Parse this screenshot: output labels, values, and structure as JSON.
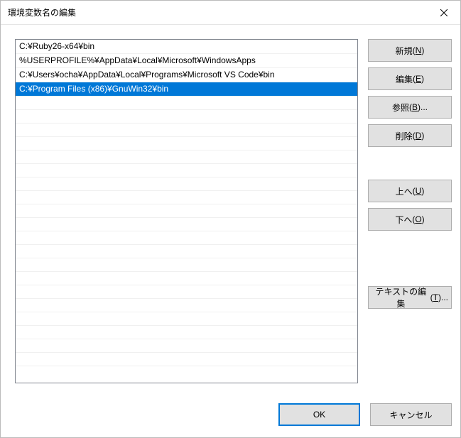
{
  "dialog": {
    "title": "環境変数名の編集"
  },
  "list": {
    "items": [
      {
        "text": "C:¥Ruby26-x64¥bin",
        "selected": false
      },
      {
        "text": "%USERPROFILE%¥AppData¥Local¥Microsoft¥WindowsApps",
        "selected": false
      },
      {
        "text": "C:¥Users¥ocha¥AppData¥Local¥Programs¥Microsoft VS Code¥bin",
        "selected": false
      },
      {
        "text": "C:¥Program Files (x86)¥GnuWin32¥bin",
        "selected": true
      }
    ],
    "empty_rows": 20
  },
  "buttons": {
    "new": {
      "label": "新規",
      "mnemonic": "N"
    },
    "edit": {
      "label": "編集",
      "mnemonic": "E"
    },
    "browse": {
      "label": "参照",
      "mnemonic": "B",
      "suffix": "..."
    },
    "delete": {
      "label": "削除",
      "mnemonic": "D"
    },
    "move_up": {
      "label": "上へ",
      "mnemonic": "U"
    },
    "move_down": {
      "label": "下へ",
      "mnemonic": "O"
    },
    "edit_text": {
      "label": "テキストの編集",
      "mnemonic": "T",
      "suffix": "..."
    },
    "ok": {
      "label": "OK"
    },
    "cancel": {
      "label": "キャンセル"
    }
  }
}
